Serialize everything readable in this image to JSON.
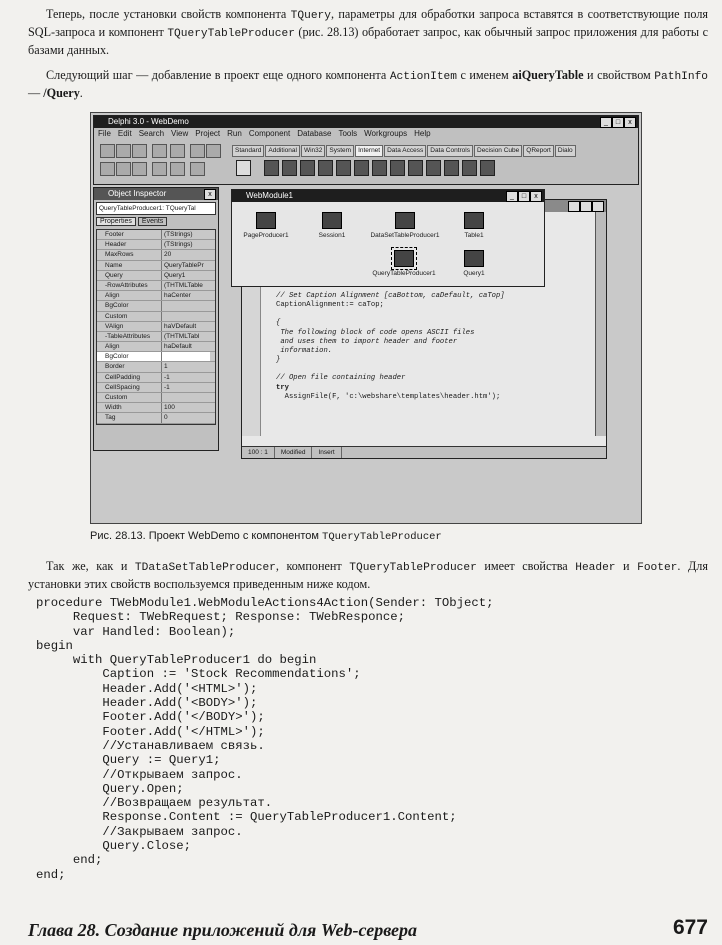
{
  "paragraph1": {
    "parts": [
      "Теперь, после установки свойств компонента ",
      "TQuery",
      ", параметры для обработки запроса вставятся в соответствующие поля SQL-запроса и компонент ",
      "TQueryTableProducer",
      " (рис. 28.13) обработает запрос, как обычный запрос приложения для работы с базами данных."
    ]
  },
  "paragraph2": {
    "parts": [
      "Следующий шаг — добавление в проект еще одного компонента ",
      "ActionItem",
      " с именем ",
      "aiQueryTable",
      " и свойством ",
      "PathInfo",
      " — ",
      "/Query",
      "."
    ]
  },
  "figure": {
    "delphi_title": "Delphi 3.0 - WebDemo",
    "menu": [
      "File",
      "Edit",
      "Search",
      "View",
      "Project",
      "Run",
      "Component",
      "Database",
      "Tools",
      "Workgroups",
      "Help"
    ],
    "palette_tabs": [
      "Standard",
      "Additional",
      "Win32",
      "System",
      "Internet",
      "Data Access",
      "Data Controls",
      "Decision Cube",
      "QReport",
      "Dialo"
    ],
    "inspector": {
      "title": "Object Inspector",
      "selected_object": "QueryTableProducer1: TQueryTal",
      "tabs": [
        "Properties",
        "Events"
      ],
      "rows": [
        {
          "k": "Footer",
          "v": "(TStrings)"
        },
        {
          "k": "Header",
          "v": "(TStrings)"
        },
        {
          "k": "MaxRows",
          "v": "20"
        },
        {
          "k": "Name",
          "v": "QueryTablePr"
        },
        {
          "k": "Query",
          "v": "Query1"
        },
        {
          "k": "-RowAttributes",
          "v": "(THTMLTable"
        },
        {
          "k": "Align",
          "v": "haCenter"
        },
        {
          "k": "BgColor",
          "v": ""
        },
        {
          "k": "Custom",
          "v": ""
        },
        {
          "k": "VAlign",
          "v": "haVDefault"
        },
        {
          "k": "-TableAttributes",
          "v": "(THTMLTabl"
        },
        {
          "k": "Align",
          "v": "haDefault"
        },
        {
          "k": "BgColor",
          "v": ""
        },
        {
          "k": "Border",
          "v": "1"
        },
        {
          "k": "CellPadding",
          "v": "-1"
        },
        {
          "k": "CellSpacing",
          "v": "-1"
        },
        {
          "k": "Custom",
          "v": ""
        },
        {
          "k": "Width",
          "v": "100"
        },
        {
          "k": "Tag",
          "v": "0"
        }
      ]
    },
    "webmodule": {
      "title": "WebModule1",
      "components": [
        "PageProducer1",
        "Session1",
        "DataSetTableProducer1",
        "Table1",
        "QueryTableProducer1",
        "Query1"
      ]
    },
    "code_lines": [
      "// Set Caption Alignment [caBottom, caDefault, caTop]",
      "CaptionAlignment:= caTop;",
      "{",
      " The following block of code opens ASCII files",
      " and uses them to import header and footer",
      " information.",
      "}",
      "// Open file containing header",
      "try",
      "  AssignFile(F, 'c:\\webshare\\templates\\header.htm');"
    ],
    "status": [
      "100 : 1",
      "Modified",
      "Insert"
    ]
  },
  "caption": {
    "prefix": "Рис. 28.13. Проект WebDemo с компонентом ",
    "code": "TQueryTableProducer"
  },
  "paragraph3": {
    "parts": [
      "Так же, как и ",
      "TDataSetTableProducer",
      ", компонент ",
      "TQueryTableProducer",
      " имеет свойства ",
      "Header",
      " и ",
      "Footer",
      ". Для установки этих свойств воспользуемся приведенным ниже кодом."
    ]
  },
  "code_listing": [
    "procedure TWebModule1.WebModuleActions4Action(Sender: TObject;",
    "     Request: TWebRequest; Response: TWebResponce;",
    "     var Handled: Boolean);",
    "begin",
    "     with QueryTableProducer1 do begin",
    "         Caption := 'Stock Recommendations';",
    "         Header.Add('<HTML>');",
    "         Header.Add('<BODY>');",
    "         Footer.Add('</BODY>');",
    "         Footer.Add('</HTML>');",
    "         //Устанавливаем связь.",
    "         Query := Query1;",
    "         //Открываем запрос.",
    "         Query.Open;",
    "         //Возвращаем результат.",
    "         Response.Content := QueryTableProducer1.Content;",
    "         //Закрываем запрос.",
    "         Query.Close;",
    "     end;",
    "end;"
  ],
  "footer": {
    "title": "Глава 28. Создание приложений для Web-сервера",
    "page_number": "677"
  }
}
